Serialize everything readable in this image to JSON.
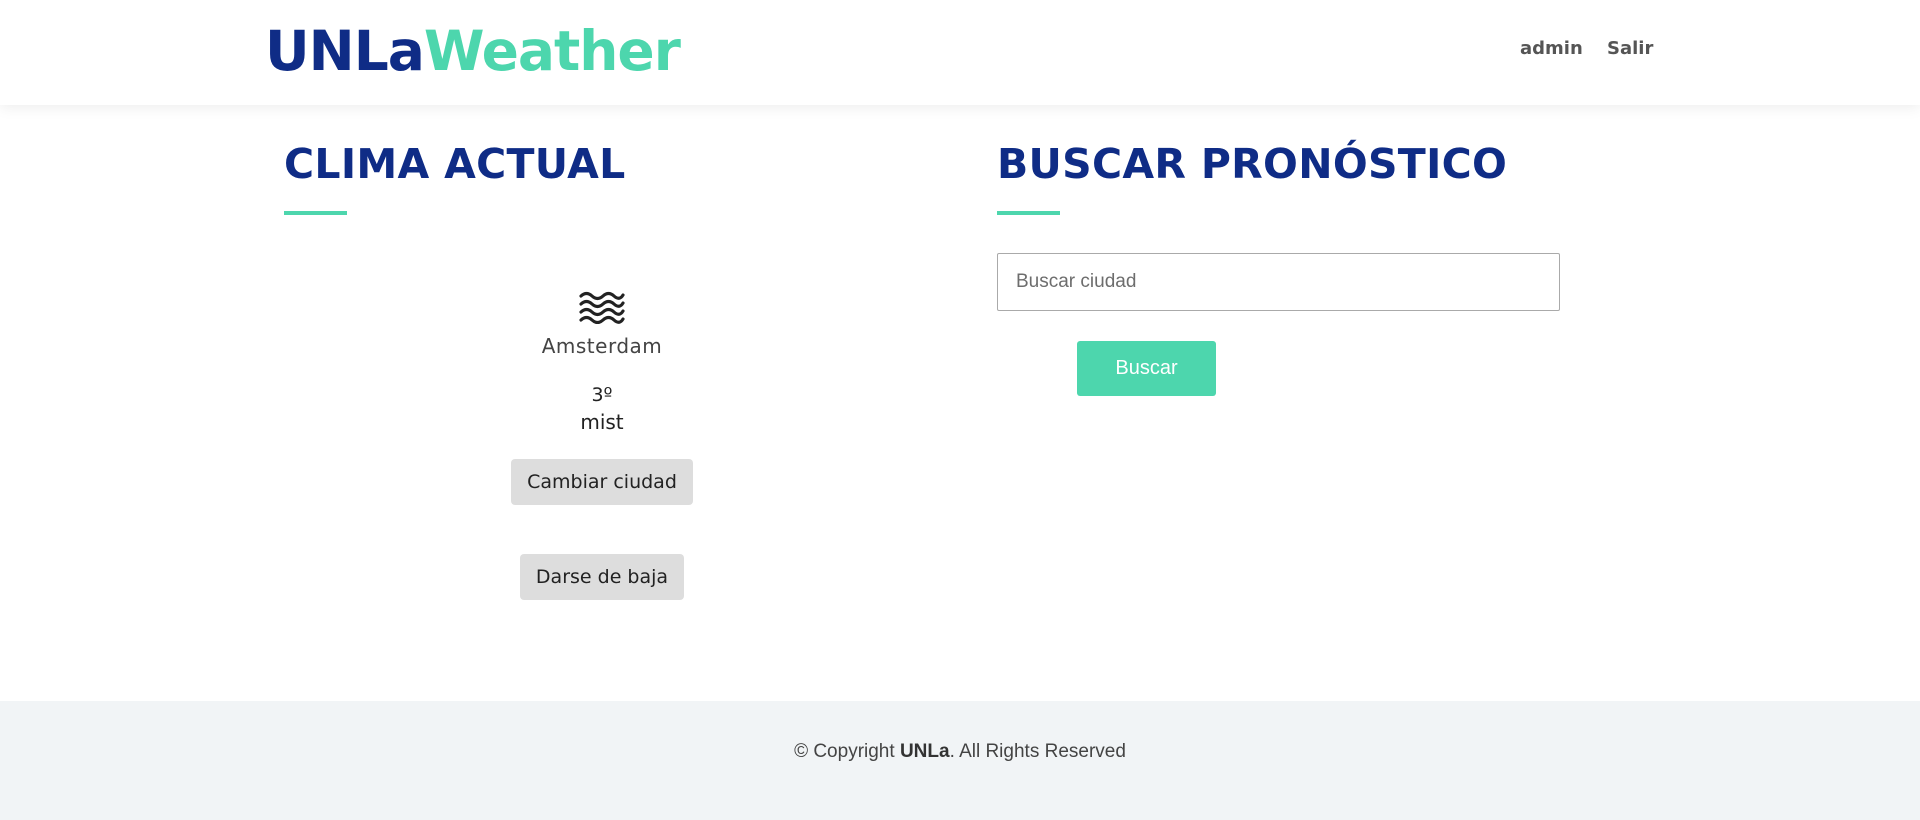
{
  "header": {
    "logo_part1": "UNLa",
    "logo_part2": "Weather",
    "nav": {
      "user": "admin",
      "logout": "Salir"
    }
  },
  "current": {
    "title": "CLIMA ACTUAL",
    "icon": "mist-icon",
    "city": "Amsterdam",
    "temperature": "3º",
    "description": "mist",
    "change_city_label": "Cambiar ciudad",
    "unsubscribe_label": "Darse de baja"
  },
  "search": {
    "title": "BUSCAR PRONÓSTICO",
    "placeholder": "Buscar ciudad",
    "value": "",
    "button_label": "Buscar"
  },
  "footer": {
    "prefix": "© Copyright ",
    "brand": "UNLa",
    "suffix": ". All Rights Reserved"
  },
  "colors": {
    "primary": "#0f2c86",
    "accent": "#4dd6ad",
    "footer_bg": "#f1f4f6",
    "button_grey": "#dddddd"
  }
}
